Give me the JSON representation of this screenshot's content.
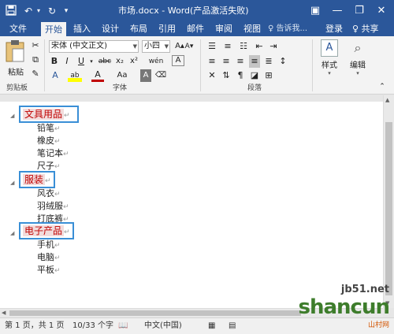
{
  "titlebar": {
    "title": "市场.docx - Word(产品激活失败)",
    "save_icon": "save-icon",
    "undo_icon": "undo-icon",
    "redo_icon": "redo-icon",
    "help_icon": "help-icon",
    "minimize_icon": "minimize-icon",
    "restore_icon": "restore-icon",
    "close_icon": "close-icon"
  },
  "tabs": [
    {
      "label": "文件"
    },
    {
      "label": "开始"
    },
    {
      "label": "插入"
    },
    {
      "label": "设计"
    },
    {
      "label": "布局"
    },
    {
      "label": "引用"
    },
    {
      "label": "邮件"
    },
    {
      "label": "审阅"
    },
    {
      "label": "视图"
    }
  ],
  "tell_me": "♀ 告诉我...",
  "login": "登录",
  "share": "♀ 共享",
  "ribbon": {
    "clipboard": {
      "paste_label": "粘贴",
      "group_label": "剪贴板"
    },
    "font": {
      "font_name": "宋体 (中文正文)",
      "font_size": "小四",
      "group_label": "字体",
      "bold": "B",
      "italic": "I",
      "underline": "U",
      "strike": "abc",
      "sub": "x₂",
      "sup": "x²",
      "grow": "A▴",
      "shrink": "A▾",
      "aa": "Aa",
      "wen": "wén",
      "clear": "A",
      "highlight": "ab",
      "color": "A",
      "border": "A"
    },
    "paragraph": {
      "group_label": "段落"
    },
    "styles": {
      "label": "样式"
    },
    "editing": {
      "label": "编辑"
    }
  },
  "document": {
    "headings": [
      {
        "text": "文具用品"
      },
      {
        "text": "服装"
      },
      {
        "text": "电子产品"
      }
    ],
    "items": [
      {
        "text": "铅笔"
      },
      {
        "text": "橡皮"
      },
      {
        "text": "笔记本"
      },
      {
        "text": "尺子"
      },
      {
        "text": "风衣"
      },
      {
        "text": "羽绒服"
      },
      {
        "text": "打底裤"
      },
      {
        "text": "手机"
      },
      {
        "text": "电脑"
      },
      {
        "text": "平板"
      }
    ],
    "paragraph_mark": "↵"
  },
  "statusbar": {
    "page": "第 1 页，共 1 页",
    "words": "10/33 个字",
    "language": "中文(中国)"
  },
  "watermark": {
    "site": "jb51.net",
    "brand": "shancun",
    "sub": "山村网"
  },
  "colors": {
    "accent": "#2b579a",
    "heading_text": "#c00000",
    "heading_box": "#3a8fd6"
  }
}
